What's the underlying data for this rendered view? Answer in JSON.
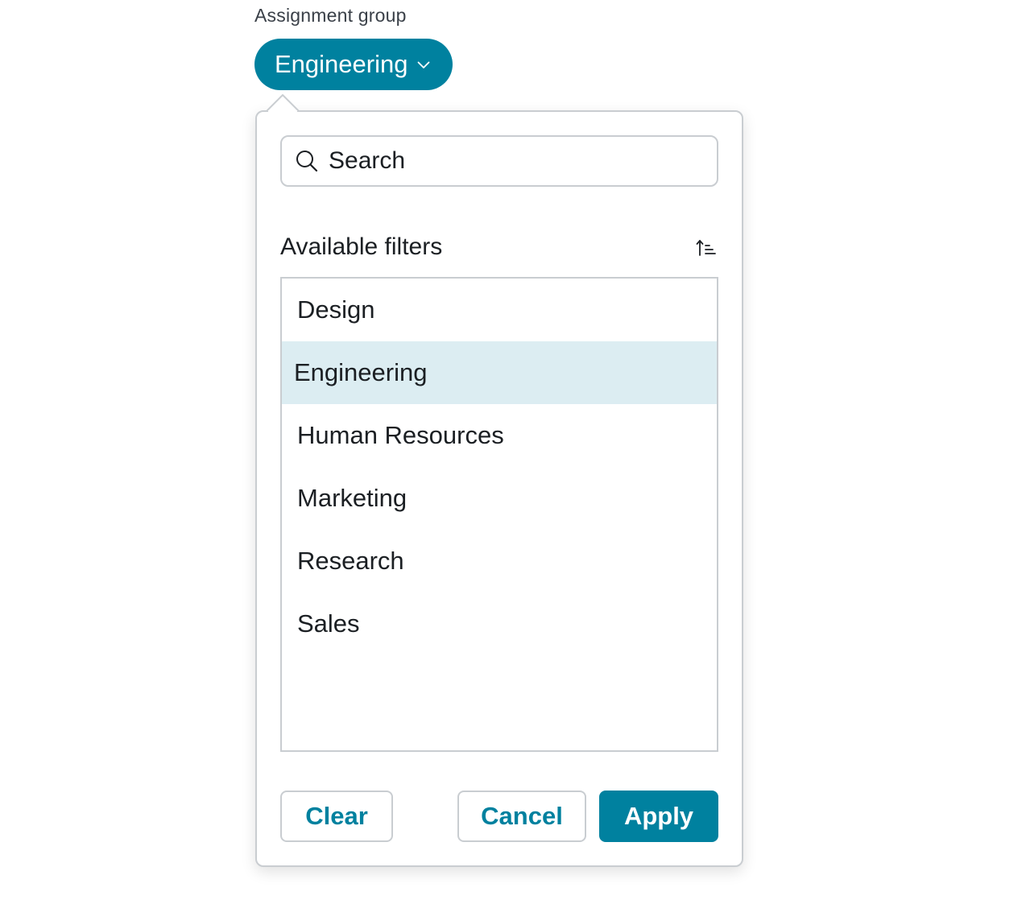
{
  "filter": {
    "label": "Assignment group",
    "selected_value": "Engineering"
  },
  "popover": {
    "search": {
      "placeholder": "Search",
      "value": ""
    },
    "section_title": "Available filters",
    "options": [
      {
        "label": "Design",
        "selected": false
      },
      {
        "label": "Engineering",
        "selected": true
      },
      {
        "label": "Human Resources",
        "selected": false
      },
      {
        "label": "Marketing",
        "selected": false
      },
      {
        "label": "Research",
        "selected": false
      },
      {
        "label": "Sales",
        "selected": false
      }
    ],
    "buttons": {
      "clear": "Clear",
      "cancel": "Cancel",
      "apply": "Apply"
    }
  },
  "icons": {
    "pill_chevron": "chevron-down-icon",
    "search": "search-icon",
    "sort": "sort-ascending-icon"
  },
  "colors": {
    "accent": "#00819f",
    "selected_row": "#dcedf2",
    "border": "#c9cdd1",
    "text": "#1b1f23"
  }
}
